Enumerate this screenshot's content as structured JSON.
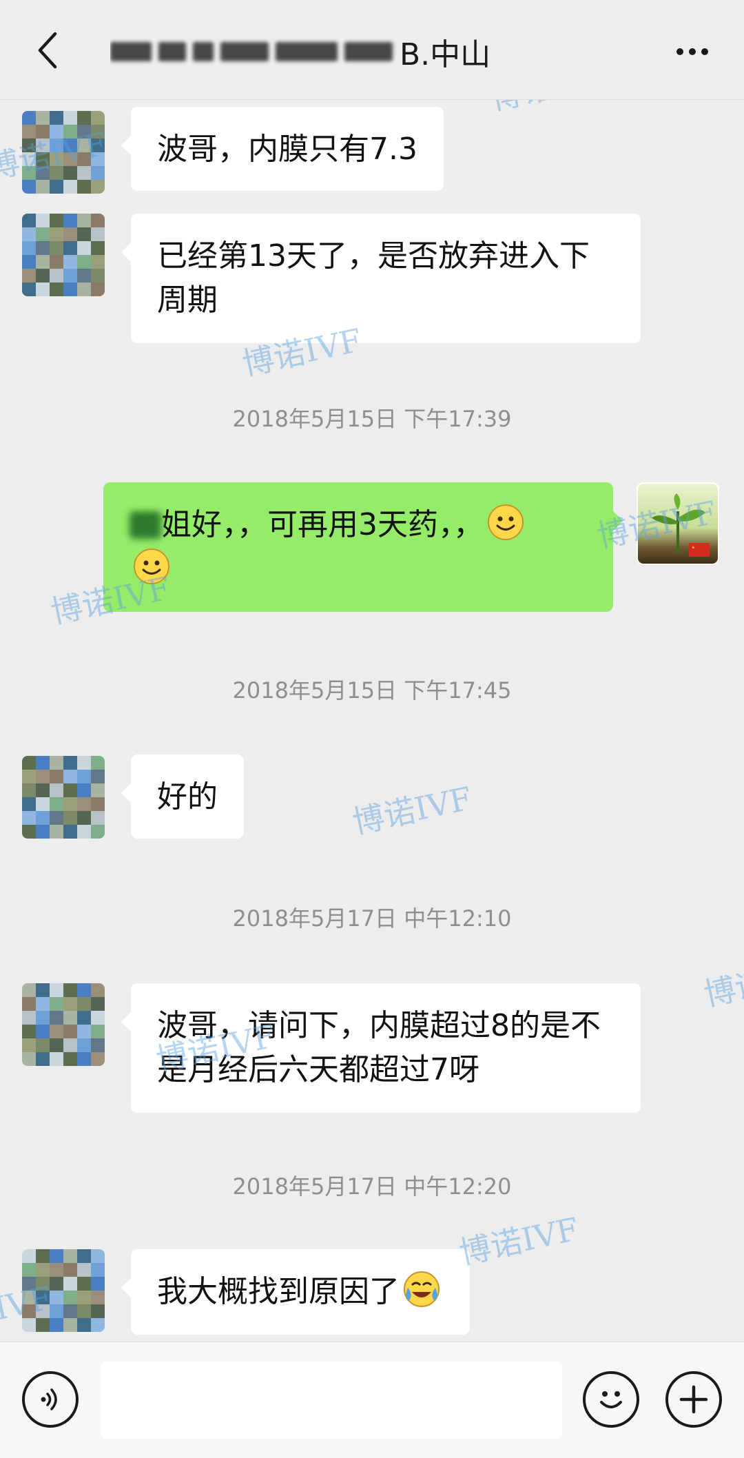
{
  "header": {
    "title_suffix": "B.中山"
  },
  "messages": [
    {
      "side": "in",
      "text": "波哥，内膜只有7.3"
    },
    {
      "side": "in",
      "text": "已经第13天了，是否放弃进入下周期"
    },
    {
      "time": "2018年5月15日 下午17:39"
    },
    {
      "side": "out",
      "text": "姐好，，可再用3天药，，"
    },
    {
      "time": "2018年5月15日 下午17:45"
    },
    {
      "side": "in",
      "text": "好的"
    },
    {
      "time": "2018年5月17日 中午12:10"
    },
    {
      "side": "in",
      "text": "波哥，请问下，内膜超过8的是不是月经后六天都超过7呀"
    },
    {
      "time": "2018年5月17日 中午12:20"
    },
    {
      "side": "in",
      "text": "我大概找到原因了"
    }
  ],
  "watermark": "博诺IVF",
  "colors": {
    "background": "#ededed",
    "incoming_bubble": "#ffffff",
    "outgoing_bubble": "#95ec69",
    "timestamp": "#8e8e8e",
    "watermark": "#5aa0dc"
  },
  "icons": {
    "back": "chevron-left-icon",
    "more": "more-dots-icon",
    "voice": "voice-icon",
    "emoji": "emoji-icon",
    "plus": "plus-icon"
  }
}
